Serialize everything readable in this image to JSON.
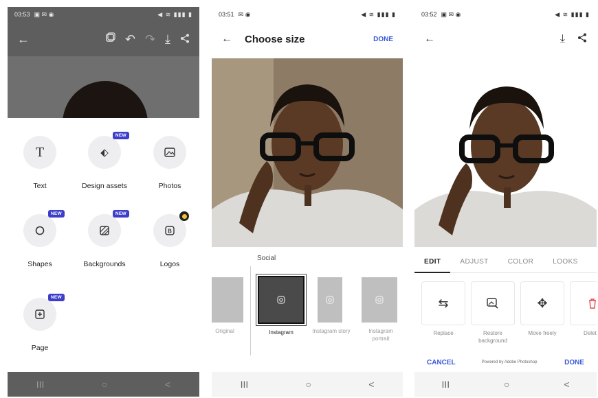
{
  "phone1": {
    "status": {
      "time": "03:53",
      "icons": "▣ ✉ ◉",
      "right": "◀ ≋ ▮▮▮ ▮"
    },
    "icons": [
      "back-arrow",
      "pages",
      "undo",
      "redo",
      "download",
      "share"
    ],
    "assets": [
      {
        "label": "Text",
        "badge": ""
      },
      {
        "label": "Design assets",
        "badge": "NEW"
      },
      {
        "label": "Photos",
        "badge": ""
      },
      {
        "label": "Shapes",
        "badge": "NEW"
      },
      {
        "label": "Backgrounds",
        "badge": "NEW"
      },
      {
        "label": "Logos",
        "badge": "premium"
      },
      {
        "label": "Page",
        "badge": "NEW"
      }
    ],
    "new_badge": "NEW"
  },
  "phone2": {
    "status": {
      "time": "03:51",
      "icons": "✉ ◉",
      "right": "◀ ≋ ▮▮▮ ▮"
    },
    "title": "Choose size",
    "done": "DONE",
    "section": "Social",
    "sizes": [
      {
        "label": "Original",
        "selected": false
      },
      {
        "label": "Instagram",
        "selected": true
      },
      {
        "label": "Instagram story",
        "selected": false
      },
      {
        "label": "Instagram portrait",
        "selected": false
      }
    ]
  },
  "phone3": {
    "status": {
      "time": "03:52",
      "icons": "▣ ✉ ◉",
      "right": "◀ ≋ ▮▮▮ ▮"
    },
    "tabs": [
      "EDIT",
      "ADJUST",
      "COLOR",
      "LOOKS"
    ],
    "active_tab": "EDIT",
    "tools": [
      "Replace",
      "Restore background",
      "Move freely",
      "Delete"
    ],
    "cancel": "CANCEL",
    "powered": "Powered by Adobe Photoshop",
    "done": "DONE"
  },
  "navbar": {
    "recent": "III",
    "home": "○",
    "back": "<"
  },
  "colors": {
    "accent": "#3a58d8",
    "badge": "#3d3ec9",
    "delete": "#e5484d"
  }
}
